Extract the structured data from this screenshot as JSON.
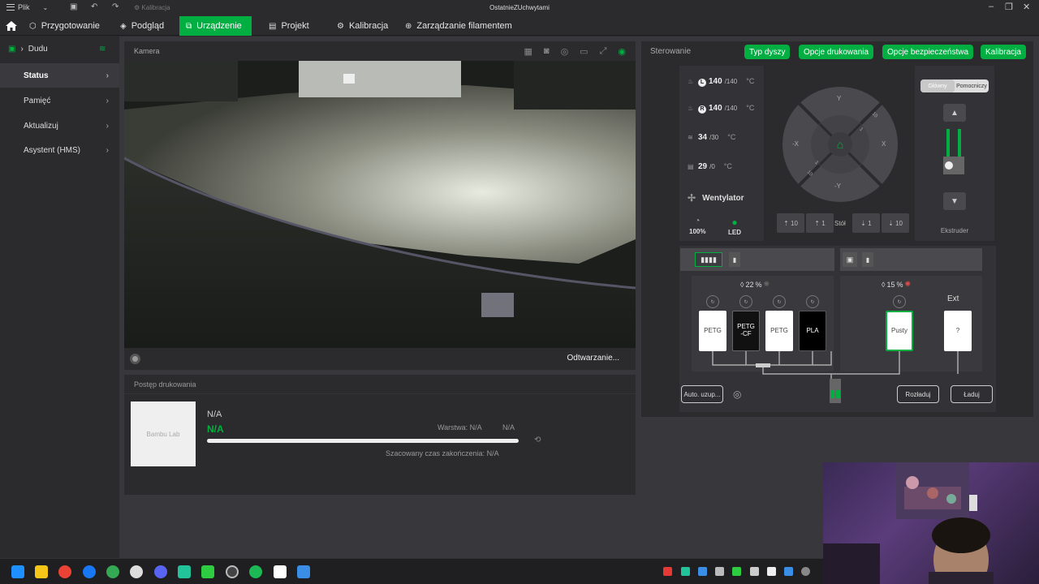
{
  "titlebar": {
    "menu_label": "Plik",
    "calibration_label": "Kalibracja",
    "window_title": "OstatnieZUchwytami"
  },
  "nav": {
    "items": [
      {
        "label": "Przygotowanie",
        "icon": "cube-icon"
      },
      {
        "label": "Podgląd",
        "icon": "layers-icon"
      },
      {
        "label": "Urządzenie",
        "icon": "device-icon",
        "active": true
      },
      {
        "label": "Projekt",
        "icon": "project-icon"
      },
      {
        "label": "Kalibracja",
        "icon": "calibration-icon"
      },
      {
        "label": "Zarządzanie filamentem",
        "icon": "filament-icon"
      }
    ]
  },
  "sidebar": {
    "device_name": "Dudu",
    "items": [
      {
        "label": "Status",
        "active": true
      },
      {
        "label": "Pamięć"
      },
      {
        "label": "Aktualizuj"
      },
      {
        "label": "Asystent (HMS)"
      }
    ]
  },
  "camera": {
    "title": "Kamera",
    "playback_label": "Odtwarzanie..."
  },
  "progress": {
    "title": "Postęp drukowania",
    "thumb_text": "Bambu Lab",
    "name": "N/A",
    "percent": "N/A",
    "layer": "Warstwa: N/A",
    "layer_value": "N/A",
    "eta": "Szacowany czas zakończenia: N/A",
    "fill": 0
  },
  "control": {
    "title": "Sterowanie",
    "buttons": [
      "Typ dyszy",
      "Opcje drukowania",
      "Opcje bezpieczeństwa",
      "Kalibracja"
    ],
    "temps": [
      {
        "badge": "L",
        "current": "140",
        "target": "/140",
        "unit": "°C"
      },
      {
        "badge": "R",
        "current": "140",
        "target": "/140",
        "unit": "°C"
      },
      {
        "badge": "",
        "current": "34",
        "target": "/30",
        "unit": "°C"
      },
      {
        "badge": "",
        "current": "29",
        "target": "/0",
        "unit": "°C"
      }
    ],
    "fan_label": "Wentylator",
    "speed": "100%",
    "led": "LED",
    "jog": {
      "y_pos": "Y",
      "y_neg": "-Y",
      "x_pos": "X",
      "x_neg": "-X",
      "ten": "10",
      "one": "1"
    },
    "z_buttons": [
      "10",
      "1",
      "1",
      "10"
    ],
    "table_label": "Stół",
    "extruder_tabs": [
      "Główny",
      "Pomocniczy"
    ],
    "extruder_label": "Ekstruder"
  },
  "ams": {
    "left_humidity": "22",
    "right_humidity": "15",
    "percent_sign": "%",
    "slots_left": [
      {
        "id": "A1",
        "label": "PETG",
        "color": "#ffffff",
        "text": "#444"
      },
      {
        "id": "A2",
        "label": "PETG\n-CF",
        "color": "#111111",
        "text": "#fff"
      },
      {
        "id": "A3",
        "label": "PETG",
        "color": "#ffffff",
        "text": "#444"
      },
      {
        "id": "A4",
        "label": "PLA",
        "color": "#000000",
        "text": "#fff"
      }
    ],
    "slot_right": {
      "label": "Pusty"
    },
    "ext_label": "Ext",
    "ext_slot": "?",
    "auto_refill": "Auto. uzup...",
    "unload": "Rozładuj",
    "load": "Ładuj"
  },
  "colors": {
    "accent": "#00ae42"
  }
}
